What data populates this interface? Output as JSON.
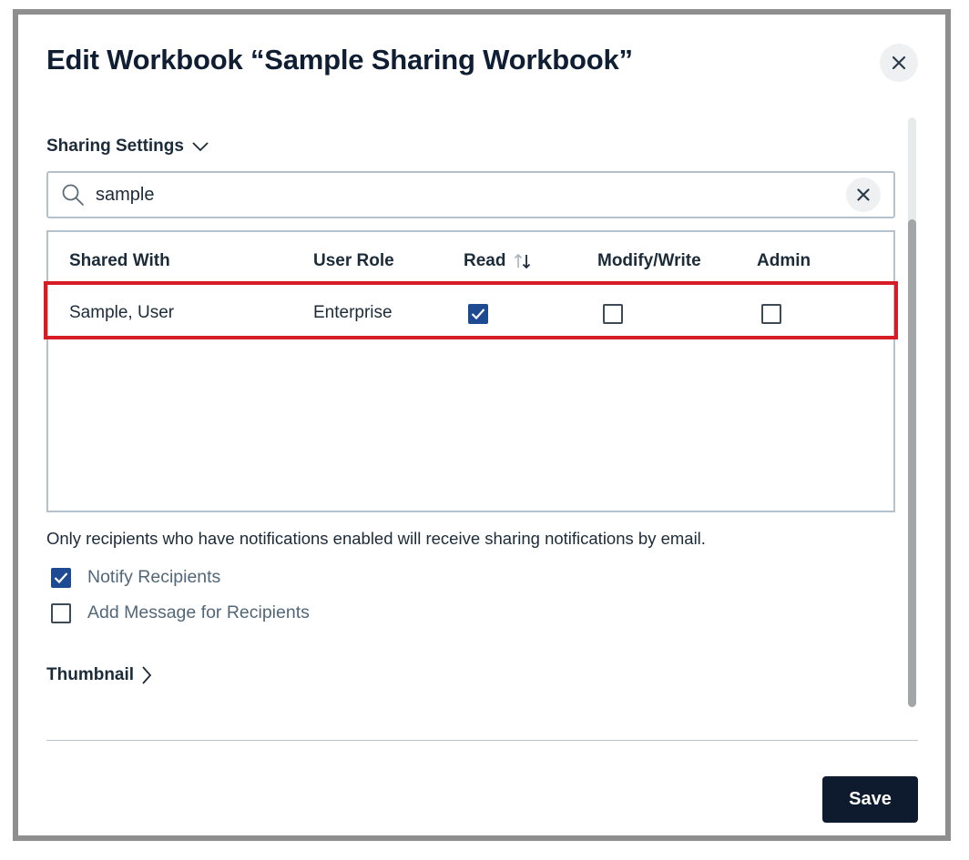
{
  "dialog": {
    "title": "Edit Workbook “Sample Sharing Workbook”",
    "close_label": "Close"
  },
  "sharing_settings": {
    "label": "Sharing Settings",
    "expanded": true,
    "search": {
      "value": "sample",
      "placeholder": ""
    },
    "table": {
      "columns": [
        "Shared With",
        "User Role",
        "Read",
        "Modify/Write",
        "Admin"
      ],
      "sorted_column": "Read",
      "rows": [
        {
          "shared_with": "Sample, User",
          "user_role": "Enterprise",
          "read": true,
          "modify_write": false,
          "admin": false
        }
      ]
    }
  },
  "notification_note": "Only recipients who have notifications enabled will receive sharing notifications by email.",
  "options": [
    {
      "label": "Notify Recipients",
      "checked": true
    },
    {
      "label": "Add Message for Recipients",
      "checked": false
    }
  ],
  "thumbnail": {
    "label": "Thumbnail",
    "expanded": false
  },
  "footer": {
    "save_label": "Save"
  },
  "colors": {
    "accent": "#1d4a91",
    "highlight": "#d81c25",
    "save_button": "#0e1a2e",
    "title_text": "#0f1e33",
    "border": "#b3c2cc"
  },
  "icons": [
    "close-icon",
    "chevron-down-icon",
    "search-icon",
    "clear-icon",
    "sort-icon",
    "checkmark-icon",
    "chevron-right-icon"
  ]
}
